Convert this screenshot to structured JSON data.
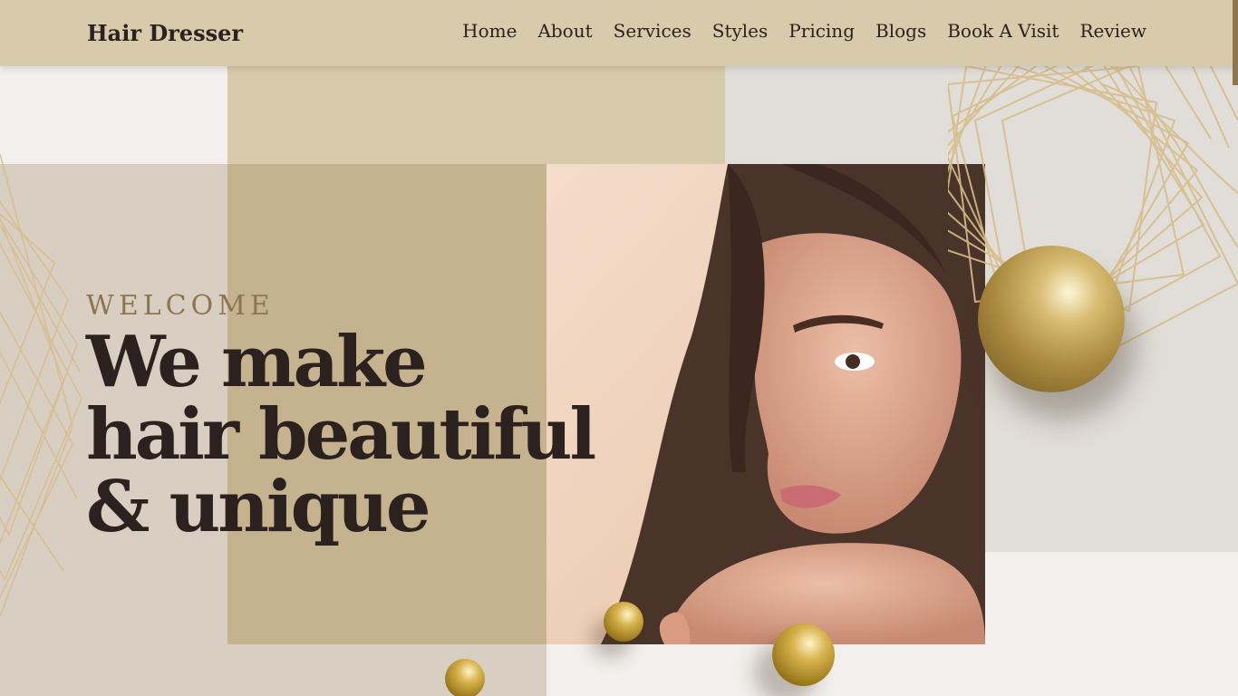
{
  "header": {
    "logo": "Hair Dresser",
    "nav": [
      "Home",
      "About",
      "Services",
      "Styles",
      "Pricing",
      "Blogs",
      "Book A Visit",
      "Review"
    ]
  },
  "hero": {
    "welcome": "WELCOME",
    "headline": [
      "We make",
      "hair beautiful",
      "& unique"
    ]
  },
  "colors": {
    "header_bg": "#d8cbac",
    "accent_gold": "#8e7551",
    "text_dark": "#2b211e"
  }
}
